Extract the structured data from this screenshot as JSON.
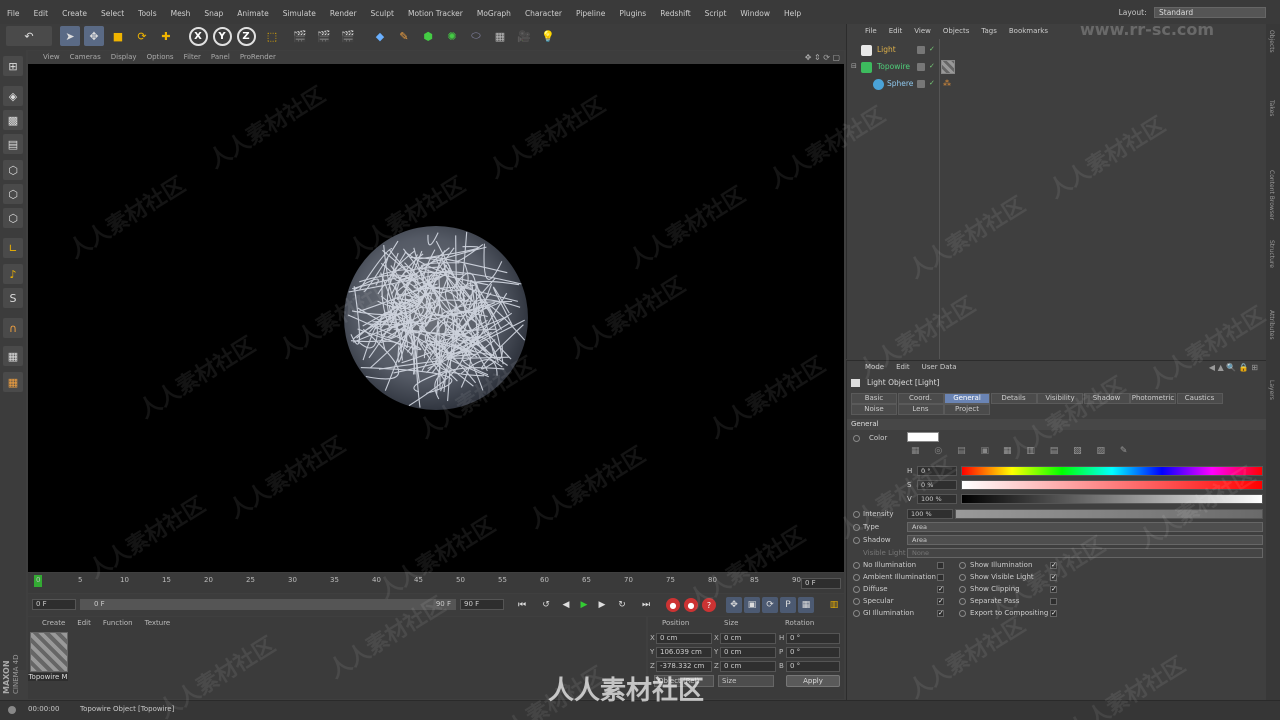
{
  "menu": [
    "File",
    "Edit",
    "Create",
    "Select",
    "Tools",
    "Mesh",
    "Snap",
    "Animate",
    "Simulate",
    "Render",
    "Sculpt",
    "Motion Tracker",
    "MoGraph",
    "Character",
    "Pipeline",
    "Plugins",
    "Redshift",
    "Script",
    "Window",
    "Help"
  ],
  "layout": {
    "label": "Layout:",
    "value": "Standard"
  },
  "viewport_menu": [
    "View",
    "Cameras",
    "Display",
    "Options",
    "Filter",
    "Panel",
    "ProRender"
  ],
  "timeline": {
    "ticks": [
      "0",
      "5",
      "10",
      "15",
      "20",
      "25",
      "30",
      "35",
      "40",
      "45",
      "50",
      "55",
      "60",
      "65",
      "70",
      "75",
      "80",
      "85",
      "90"
    ],
    "current_frame": "0 F",
    "start": "0 F",
    "range_start": "0 F",
    "range_end": "90 F",
    "end": "90 F"
  },
  "material_manager": {
    "menu": [
      "Create",
      "Edit",
      "Function",
      "Texture"
    ],
    "material_name": "Topowire M"
  },
  "coordinates": {
    "headers": {
      "position": "Position",
      "size": "Size",
      "rotation": "Rotation"
    },
    "rows": [
      {
        "axis": "X",
        "pos": "0 cm",
        "size": "0 cm",
        "rot_axis": "H",
        "rot": "0 °"
      },
      {
        "axis": "Y",
        "pos": "106.039 cm",
        "size": "0 cm",
        "rot_axis": "P",
        "rot": "0 °"
      },
      {
        "axis": "Z",
        "pos": "-378.332 cm",
        "size": "0 cm",
        "rot_axis": "B",
        "rot": "0 °"
      }
    ],
    "mode": "Object (Rel)",
    "size_mode": "Size",
    "apply": "Apply"
  },
  "logo": {
    "brand": "MAXON",
    "product": "CINEMA 4D"
  },
  "status": {
    "time": "00:00:00",
    "message": "Topowire Object [Topowire]"
  },
  "object_manager": {
    "menu": [
      "File",
      "Edit",
      "View",
      "Objects",
      "Tags",
      "Bookmarks"
    ],
    "objects": [
      {
        "name": "Light",
        "color": "#e8e8e8"
      },
      {
        "name": "Topowire",
        "color": "#3dbb5e"
      },
      {
        "name": "Sphere",
        "color": "#4aa3d8"
      }
    ]
  },
  "attributes": {
    "menu": [
      "Mode",
      "Edit",
      "User Data"
    ],
    "title": "Light Object [Light]",
    "tabs_row1": [
      "Basic",
      "Coord.",
      "General",
      "Details",
      "Visibility",
      "Shadow",
      "Photometric",
      "Caustics"
    ],
    "tabs_row2": [
      "Noise",
      "Lens",
      "Project"
    ],
    "active_tab": "General",
    "section": "General",
    "color_label": "Color",
    "h": {
      "label": "H",
      "value": "0 °"
    },
    "s": {
      "label": "S",
      "value": "0 %"
    },
    "v": {
      "label": "V",
      "value": "100 %"
    },
    "intensity": {
      "label": "Intensity",
      "value": "100 %"
    },
    "type": {
      "label": "Type",
      "value": "Area"
    },
    "shadow": {
      "label": "Shadow",
      "value": "Area"
    },
    "visible_light": {
      "label": "Visible Light",
      "value": "None"
    },
    "left_checks": [
      {
        "label": "No Illumination",
        "checked": false
      },
      {
        "label": "Ambient Illumination",
        "checked": false
      },
      {
        "label": "Diffuse",
        "checked": true
      },
      {
        "label": "Specular",
        "checked": true
      },
      {
        "label": "GI Illumination",
        "checked": true
      }
    ],
    "right_checks": [
      {
        "label": "Show Illumination",
        "checked": true
      },
      {
        "label": "Show Visible Light",
        "checked": true
      },
      {
        "label": "Show Clipping",
        "checked": true
      },
      {
        "label": "Separate Pass",
        "checked": false
      },
      {
        "label": "Export to Compositing",
        "checked": true
      }
    ]
  },
  "right_tabs": [
    "Objects",
    "Takes",
    "Content Browser",
    "Structure",
    "Attributes",
    "Layers"
  ],
  "watermark": {
    "text": "人人素材社区",
    "url": "www.rr-sc.com"
  }
}
